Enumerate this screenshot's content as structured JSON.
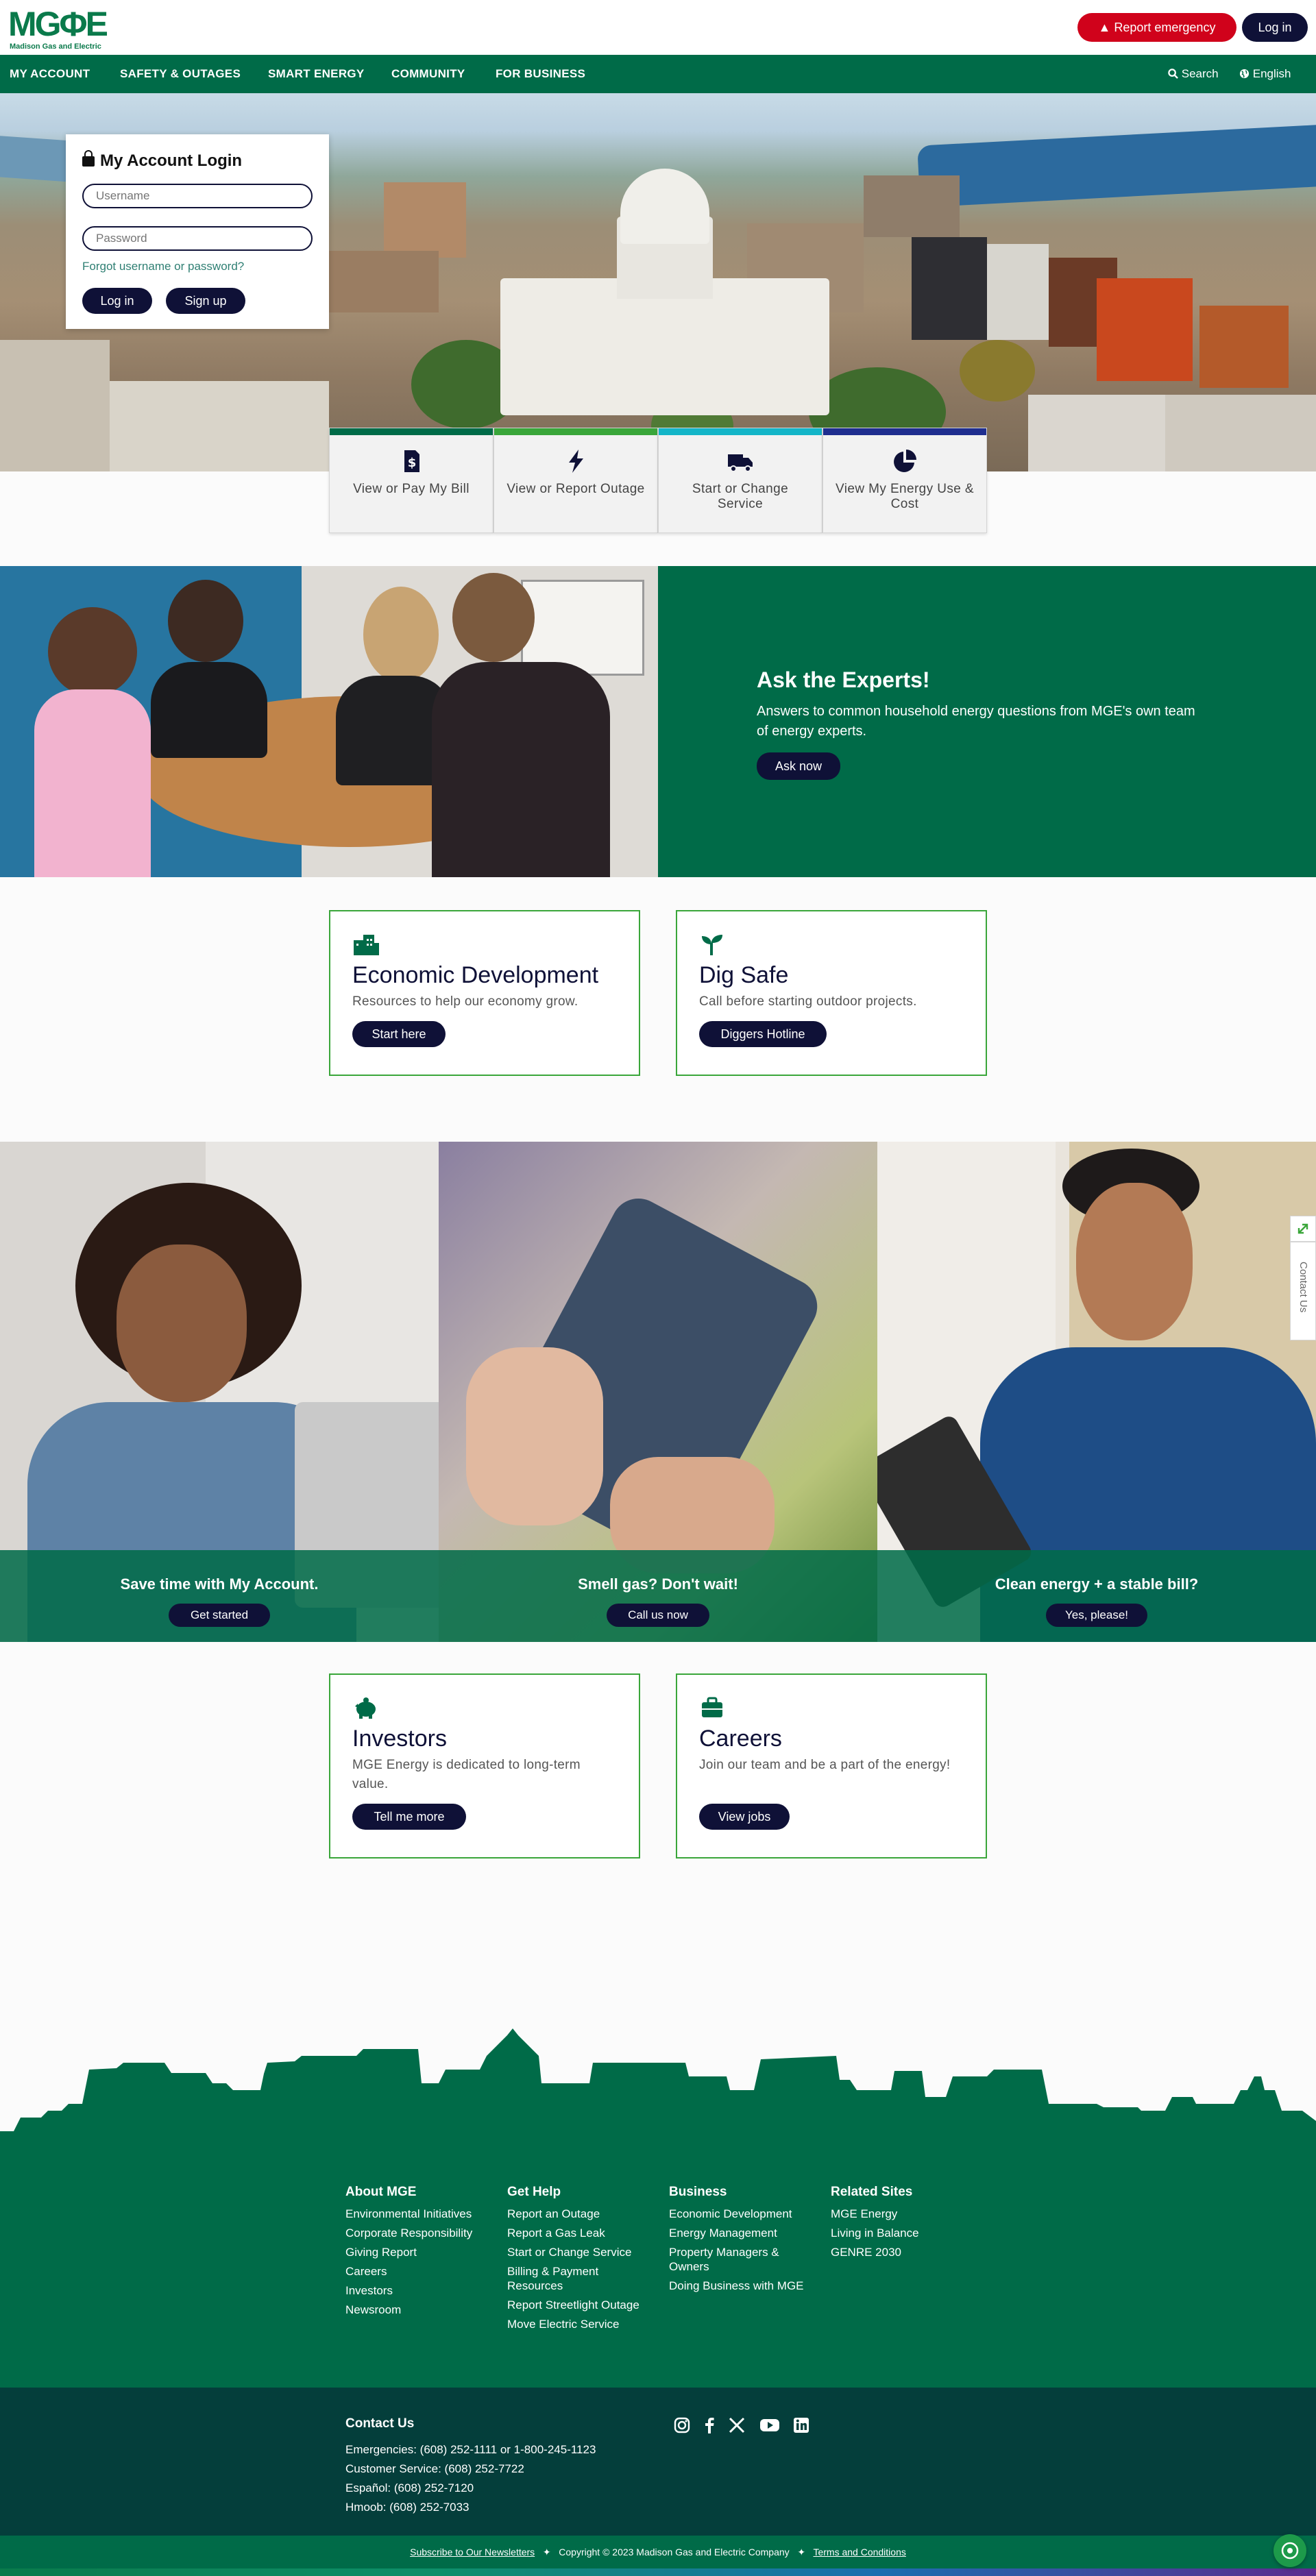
{
  "header": {
    "logo_word": "MGΦE",
    "logo_sub": "Madison Gas and Electric",
    "emergency_label": "Report emergency",
    "login_label": "Log in"
  },
  "nav": {
    "items": [
      "MY ACCOUNT",
      "SAFETY & OUTAGES",
      "SMART ENERGY",
      "COMMUNITY",
      "FOR BUSINESS"
    ],
    "search_label": "Search",
    "language_label": "English"
  },
  "login": {
    "title": "My Account Login",
    "username_placeholder": "Username",
    "password_placeholder": "Password",
    "forgot": "Forgot username or password?",
    "login_button": "Log in",
    "signup_button": "Sign up"
  },
  "tiles": [
    {
      "label": "View or Pay My Bill",
      "color": "#006b48",
      "icon": "bill-icon"
    },
    {
      "label": "View or Report Outage",
      "color": "#3aa63a",
      "icon": "lightning-icon"
    },
    {
      "label": "Start or Change Service",
      "color": "#14b5c8",
      "icon": "truck-icon"
    },
    {
      "label": "View My Energy Use & Cost",
      "color": "#1f2e8f",
      "icon": "pie-chart-icon"
    }
  ],
  "experts": {
    "title": "Ask the Experts!",
    "description": "Answers to common household energy questions from MGE's own team of energy experts.",
    "button": "Ask now"
  },
  "cards_top": [
    {
      "title": "Economic Development",
      "description": "Resources to help our economy grow.",
      "button": "Start here",
      "icon": "buildings-icon"
    },
    {
      "title": "Dig Safe",
      "description": "Call before starting outdoor projects.",
      "button": "Diggers Hotline",
      "icon": "sprout-icon"
    }
  ],
  "promos": [
    {
      "title": "Save time with My Account.",
      "button": "Get started"
    },
    {
      "title": "Smell gas? Don't wait!",
      "button": "Call us now"
    },
    {
      "title": "Clean energy + a stable bill?",
      "button": "Yes, please!"
    }
  ],
  "contact_tab": "Contact Us",
  "cards_bottom": [
    {
      "title": "Investors",
      "description": "MGE Energy is dedicated to long-term value.",
      "button": "Tell me more",
      "icon": "piggy-bank-icon"
    },
    {
      "title": "Careers",
      "description": "Join our team and be a part of the energy!",
      "button": "View jobs",
      "icon": "briefcase-icon"
    }
  ],
  "footer": {
    "columns": [
      {
        "title": "About MGE",
        "links": [
          "Environmental Initiatives",
          "Corporate Responsibility",
          "Giving Report",
          "Careers",
          "Investors",
          "Newsroom"
        ]
      },
      {
        "title": "Get Help",
        "links": [
          "Report an Outage",
          "Report a Gas Leak",
          "Start or Change Service",
          "Billing & Payment Resources",
          "Report Streetlight Outage",
          "Move Electric Service"
        ]
      },
      {
        "title": "Business",
        "links": [
          "Economic Development",
          "Energy Management",
          "Property Managers & Owners",
          "Doing Business with MGE"
        ]
      },
      {
        "title": "Related Sites",
        "links": [
          "MGE Energy",
          "Living in Balance",
          "GENRE 2030"
        ]
      }
    ],
    "contact": {
      "title": "Contact Us",
      "lines": [
        "Emergencies: (608) 252-1111 or 1-800-245-1123",
        "Customer Service: (608) 252-7722",
        "Español: (608) 252-7120",
        "Hmoob: (608) 252-7033"
      ]
    },
    "social": [
      "instagram-icon",
      "facebook-icon",
      "x-icon",
      "youtube-icon",
      "linkedin-icon"
    ],
    "legal": {
      "newsletter": "Subscribe to Our Newsletters",
      "copyright": "Copyright © 2023 Madison Gas and Electric Company",
      "terms": "Terms and Conditions",
      "separator": "✦"
    }
  }
}
